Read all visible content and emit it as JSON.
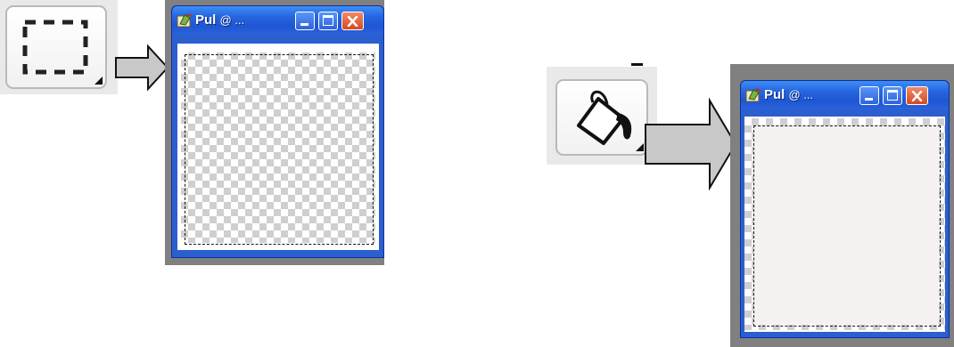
{
  "left_panel": {
    "tool": "rectangle-select-tool",
    "window": {
      "title": "Pul",
      "title_suffix": "@ ...",
      "buttons": [
        "minimize",
        "maximize",
        "close"
      ],
      "canvas": "transparent"
    }
  },
  "right_panel": {
    "tool": "fill-tool",
    "window": {
      "title": "Pul",
      "title_suffix": "@ ...",
      "buttons": [
        "minimize",
        "maximize",
        "close"
      ],
      "canvas": "filled"
    }
  },
  "colors": {
    "titlebar": "#2767e0",
    "close_button": "#d44a22",
    "fill": "#f6f1f1",
    "frame": "#808080",
    "arrow_fill": "#c8c8c8"
  }
}
